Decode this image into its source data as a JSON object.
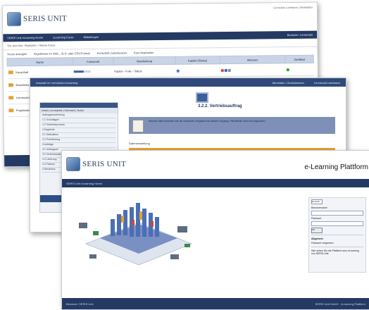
{
  "w1": {
    "brand": "SERIS UNIT",
    "top_right": "Cornelius Lehmann | Abmelden",
    "nav": [
      "SERIS Unit eLearning Home",
      "eLearning Kurse",
      "Mitteilungen"
    ],
    "nav_right": "Benutzer: Lernender",
    "breadcrumb": "Sie sind hier: Startseite > Meine Kurse",
    "tools": [
      "Kurse anzeigen",
      "Ergebnisse im XML-, XLS- oder CSV-Format",
      "Fortschritt zurücksetzen",
      "Kurs bearbeiten"
    ],
    "columns": [
      "Name",
      "Fortschritt",
      "Bearbeitung",
      "Kapitel (Status)",
      "Aktionen",
      "Zertifikat"
    ],
    "rows": [
      {
        "name": "Kursinhalt",
        "progress": 0.6,
        "note": "Kapitel - Folie - Status"
      },
      {
        "name": "Einarbeitung",
        "progress": 0.35,
        "note": ""
      },
      {
        "name": "Lernmodul",
        "progress": 0.0,
        "note": ""
      },
      {
        "name": "Projektarbeit",
        "progress": 0.0,
        "note": ""
      }
    ]
  },
  "w2": {
    "header": "Auswahl im Lernmodul eLearning",
    "header_right": [
      "Abmelden / Zurücksetzen",
      "Lernmodul verlassen"
    ],
    "side_tabs": "Inhalt | Lernobjekte | Übersicht | Suche",
    "side_items": [
      "Auftragsbearbeitung",
      "1.1 Grundlagen",
      "1.2 Vertriebsprozess",
      "2 Angebote",
      "2.1 Kalkulation",
      "2.2 Preisfindung",
      "3 Aufträge",
      "3.1 Auftragsart",
      "3.2 Vertriebsauftrag",
      "3.3 Lieferung",
      "3.4 Faktura",
      "4 Abschluss"
    ],
    "title": "3.2.2. Vertriebsauftrag",
    "note": "Hinweis: Bitte beachten Sie die markierten Eingaben bei diesem Vorgang. Pflichtfelder sind hervorgehoben.",
    "label": "Dateneinstellung"
  },
  "w3": {
    "brand": "SERIS UNIT",
    "platform": "e-Learning Plattform",
    "nav": "SERIS Unit eLearning Home",
    "login": {
      "lang": "Deutsch",
      "user_label": "Benutzername",
      "pass_label": "Passwort",
      "submit": "OK",
      "section": "Allgemein",
      "link": "Passwort vergessen",
      "info": "Hier sehen Sie die Plattform zum eLearning von SERIS Unit."
    },
    "footer_left": "Benutzer: SERIS Unit",
    "footer_right": "SERIS Unit GmbH · eLearning Plattform"
  }
}
